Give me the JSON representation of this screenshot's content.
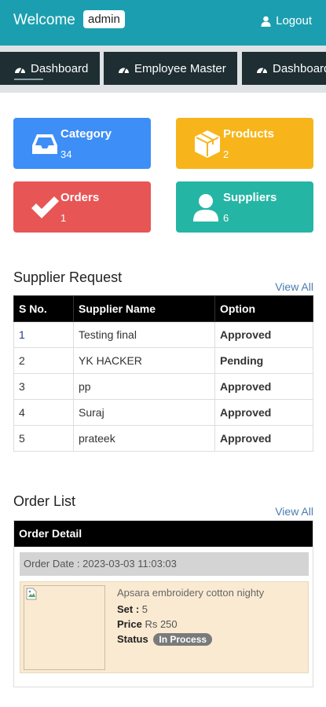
{
  "header": {
    "welcome": "Welcome",
    "user_badge": "admin",
    "logout_label": "Logout"
  },
  "nav": {
    "tabs": [
      {
        "label": "Dashboard",
        "icon": "dashboard-icon"
      },
      {
        "label": "Employee Master",
        "icon": "dashboard-icon"
      },
      {
        "label": "Dashboard",
        "icon": "dashboard-icon"
      }
    ]
  },
  "cards": [
    {
      "title": "Category",
      "count": "34",
      "color": "#3d8ef7",
      "icon": "inbox-icon"
    },
    {
      "title": "Products",
      "count": "2",
      "color": "#f7b51b",
      "icon": "box-icon"
    },
    {
      "title": "Orders",
      "count": "1",
      "color": "#e75555",
      "icon": "check-icon"
    },
    {
      "title": "Suppliers",
      "count": "6",
      "color": "#25b5a4",
      "icon": "user-icon"
    }
  ],
  "supplier_request": {
    "title": "Supplier Request",
    "view_all": "View All",
    "columns": [
      "S No.",
      "Supplier Name",
      "Option"
    ],
    "rows": [
      {
        "sno": "1",
        "name": "Testing final",
        "status": "Approved"
      },
      {
        "sno": "2",
        "name": "YK HACKER",
        "status": "Pending"
      },
      {
        "sno": "3",
        "name": "pp",
        "status": "Approved"
      },
      {
        "sno": "4",
        "name": "Suraj",
        "status": "Approved"
      },
      {
        "sno": "5",
        "name": "prateek",
        "status": "Approved"
      }
    ]
  },
  "order_list": {
    "title": "Order List",
    "view_all": "View All",
    "header": "Order Detail",
    "order_date": "Order Date : 2023-03-03 11:03:03",
    "item": {
      "name": "Apsara embroidery cotton nighty",
      "set_label": "Set :",
      "set_value": "5",
      "price_label": "Price",
      "price_value": "Rs 250",
      "status_label": "Status",
      "status_value": "In Process"
    }
  },
  "colors": {
    "topbar": "#1b9fb0",
    "nav_tab": "#1e2e33",
    "approved": "#2e8b2e",
    "pending": "#e53030"
  }
}
